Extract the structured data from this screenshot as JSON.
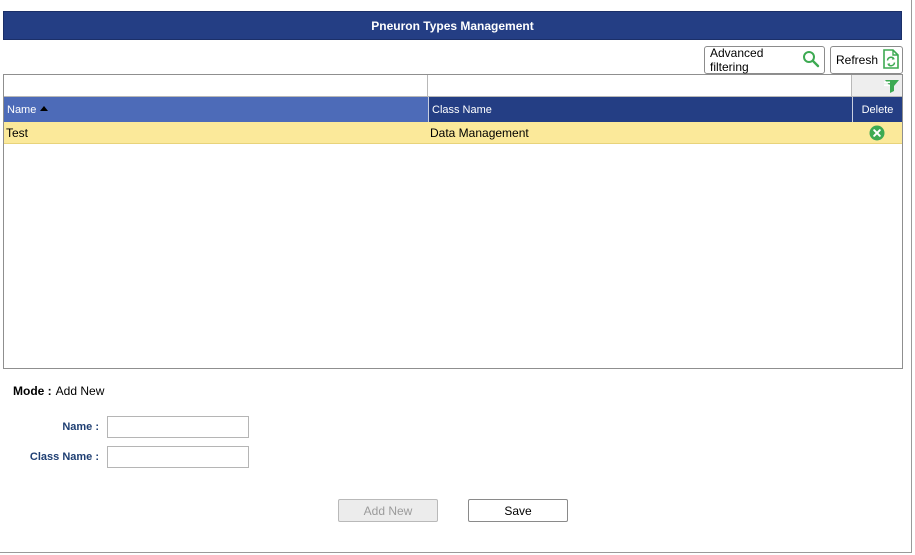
{
  "header": {
    "title": "Pneuron Types Management"
  },
  "toolbar": {
    "advanced_filtering_label": "Advanced filtering",
    "refresh_label": "Refresh"
  },
  "grid": {
    "columns": [
      {
        "label": "Name",
        "sorted": "ascending"
      },
      {
        "label": "Class Name"
      },
      {
        "label": "Delete"
      }
    ],
    "filters": {
      "name": "",
      "class_name": ""
    },
    "rows": [
      {
        "name": "Test",
        "class_name": "Data Management",
        "delete_icon": "delete-icon"
      }
    ]
  },
  "form": {
    "mode_label": "Mode :",
    "mode_value": "Add New",
    "name_label": "Name :",
    "name_value": "",
    "class_name_label": "Class Name :",
    "class_name_value": "",
    "add_new_label": "Add New",
    "save_label": "Save"
  },
  "colors": {
    "title_bar": "#243e84",
    "sorted_header": "#4d6bb8",
    "header": "#243e84",
    "selected_row": "#fbe99a",
    "icon_green": "#3daa52"
  }
}
